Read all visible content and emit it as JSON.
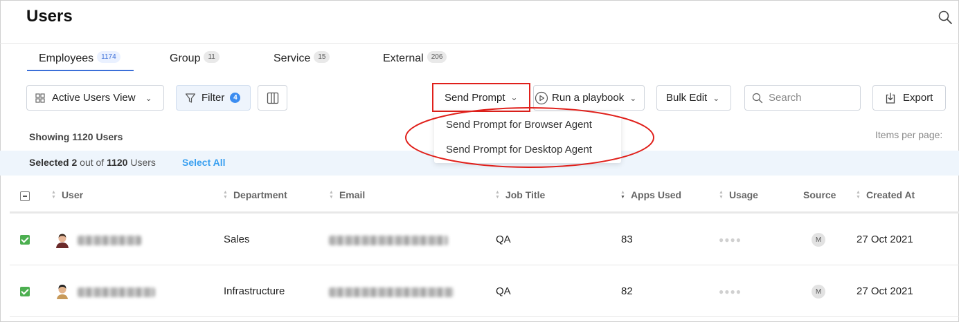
{
  "header": {
    "title": "Users"
  },
  "tabs": [
    {
      "label": "Employees",
      "count": "1174"
    },
    {
      "label": "Group",
      "count": "11"
    },
    {
      "label": "Service",
      "count": "15"
    },
    {
      "label": "External",
      "count": "206"
    }
  ],
  "toolbar": {
    "view_label": "Active Users View",
    "filter_label": "Filter",
    "filter_count": "4",
    "send_prompt_label": "Send Prompt",
    "playbook_label": "Run a playbook",
    "bulk_edit_label": "Bulk Edit",
    "search_placeholder": "Search",
    "export_label": "Export"
  },
  "dropdown": {
    "items": [
      "Send Prompt for Browser Agent",
      "Send Prompt for Desktop Agent"
    ]
  },
  "summary": {
    "showing": "Showing 1120 Users",
    "items_per_page": "Items per page:",
    "selected_prefix": "Selected",
    "selected_count": "2",
    "selected_mid": "out of",
    "selected_total": "1120",
    "selected_suffix": "Users",
    "select_all": "Select All"
  },
  "table": {
    "columns": [
      "User",
      "Department",
      "Email",
      "Job Title",
      "Apps Used",
      "Usage",
      "Source",
      "Created At"
    ],
    "rows": [
      {
        "department": "Sales",
        "job_title": "QA",
        "apps_used": "83",
        "source": "M",
        "created_at": "27 Oct 2021"
      },
      {
        "department": "Infrastructure",
        "job_title": "QA",
        "apps_used": "82",
        "source": "M",
        "created_at": "27 Oct 2021"
      }
    ]
  },
  "colors": {
    "accent": "#3b6fd8",
    "annotation_red": "#e0201b",
    "checkbox_green": "#4caf50",
    "select_all": "#3aa0f0"
  }
}
